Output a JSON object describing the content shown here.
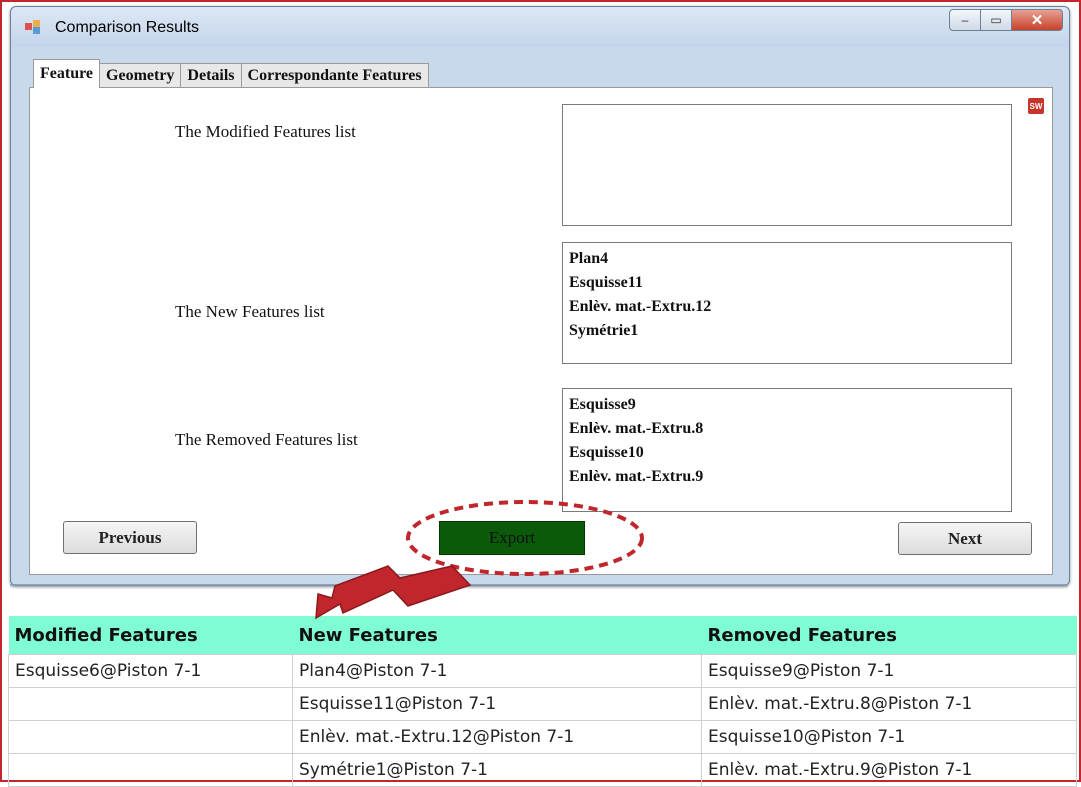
{
  "window": {
    "title": "Comparison Results",
    "controls": {
      "minimize": "–",
      "maximize": "▭",
      "close": "✕"
    }
  },
  "tabs": [
    "Feature",
    "Geometry",
    "Details",
    "Correspondante Features"
  ],
  "feature_tab": {
    "modified_label": "The Modified Features list",
    "new_label": "The New Features list",
    "removed_label": "The Removed Features list",
    "modified_items": [],
    "new_items": [
      "Plan4",
      "Esquisse11",
      "Enlèv. mat.-Extru.12",
      "Symétrie1"
    ],
    "removed_items": [
      "Esquisse9",
      "Enlèv. mat.-Extru.8",
      "Esquisse10",
      "Enlèv. mat.-Extru.9"
    ],
    "sw_icon": "SW"
  },
  "buttons": {
    "previous": "Previous",
    "export": "Export",
    "next": "Next"
  },
  "export_table": {
    "headers": [
      "Modified Features",
      "New Features",
      "Removed Features"
    ],
    "rows": [
      [
        "Esquisse6@Piston 7-1",
        "Plan4@Piston 7-1",
        "Esquisse9@Piston 7-1"
      ],
      [
        "",
        "Esquisse11@Piston 7-1",
        "Enlèv. mat.-Extru.8@Piston 7-1"
      ],
      [
        "",
        "Enlèv. mat.-Extru.12@Piston 7-1",
        "Esquisse10@Piston 7-1"
      ],
      [
        "",
        "Symétrie1@Piston 7-1",
        "Enlèv. mat.-Extru.9@Piston 7-1"
      ]
    ]
  },
  "colors": {
    "annotation": "#c0262b",
    "export_button": "#0a5a0a",
    "table_header": "#7ffcd4"
  }
}
